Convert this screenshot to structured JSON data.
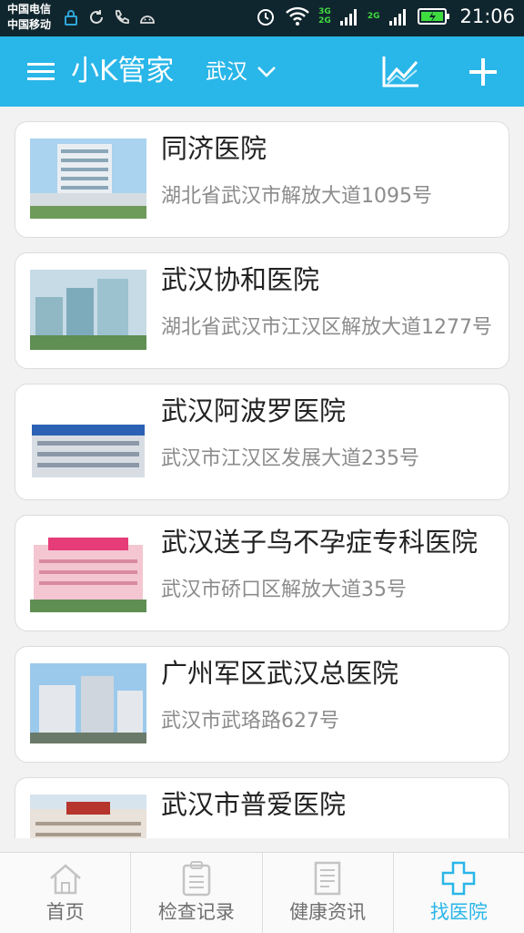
{
  "status_bar": {
    "carrier_1": "中国电信",
    "carrier_2": "中国移动",
    "network_top": "3G",
    "network_bottom": "2G",
    "network_2": "2G",
    "time": "21:06",
    "icons": [
      "lock-icon",
      "sync-icon",
      "phone-icon",
      "android-icon",
      "alarm-icon",
      "wifi-icon",
      "signal-icon",
      "battery-icon"
    ]
  },
  "app_bar": {
    "title": "小K管家",
    "city": "武汉",
    "icons": [
      "menu-icon",
      "chevron-down-icon",
      "trend-chart-icon",
      "plus-icon"
    ],
    "accent_color": "#29b6e8"
  },
  "hospitals": [
    {
      "name": "同济医院",
      "address": "湖北省武汉市解放大道1095号"
    },
    {
      "name": "武汉协和医院",
      "address": "湖北省武汉市江汉区解放大道1277号"
    },
    {
      "name": "武汉阿波罗医院",
      "address": "武汉市江汉区发展大道235号"
    },
    {
      "name": "武汉送子鸟不孕症专科医院",
      "address": "武汉市硚口区解放大道35号"
    },
    {
      "name": "广州军区武汉总医院",
      "address": "武汉市武珞路627号"
    },
    {
      "name": "武汉市普爱医院",
      "address": ""
    }
  ],
  "tabs": [
    {
      "label": "首页",
      "icon": "home-icon",
      "active": false
    },
    {
      "label": "检查记录",
      "icon": "clipboard-icon",
      "active": false
    },
    {
      "label": "健康资讯",
      "icon": "document-icon",
      "active": false
    },
    {
      "label": "找医院",
      "icon": "hospital-cross-icon",
      "active": true
    }
  ]
}
